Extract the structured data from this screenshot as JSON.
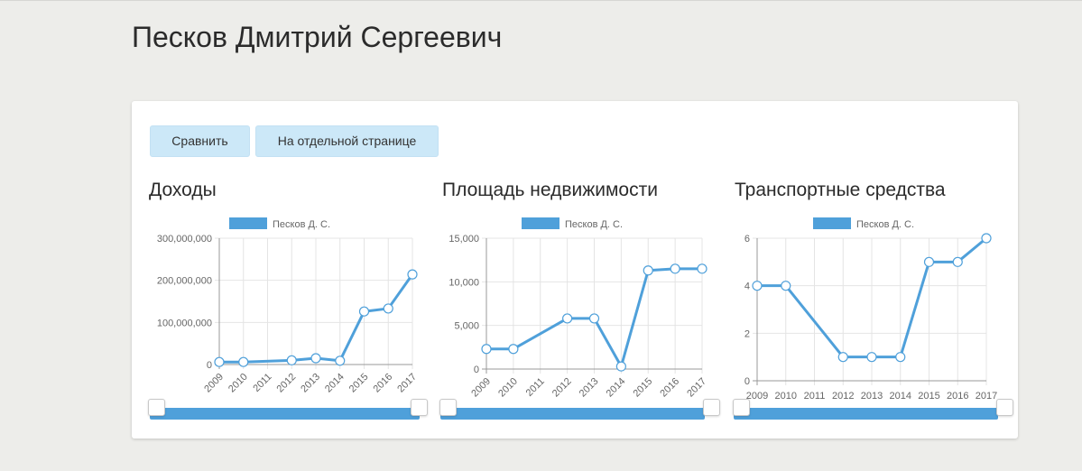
{
  "page": {
    "title": "Песков Дмитрий Сергеевич"
  },
  "toolbar": {
    "compare_label": "Сравнить",
    "separate_page_label": "На отдельной странице"
  },
  "colors": {
    "line": "#4fa0da",
    "grid": "#e4e4e4",
    "axis": "#999999"
  },
  "chart_data": [
    {
      "type": "line",
      "title": "Доходы",
      "categories": [
        "2009",
        "2010",
        "2011",
        "2012",
        "2013",
        "2014",
        "2015",
        "2016",
        "2017"
      ],
      "series": [
        {
          "name": "Песков Д. С.",
          "values": [
            6000000,
            6000000,
            null,
            10000000,
            15000000,
            9000000,
            126000000,
            133000000,
            214000000
          ]
        }
      ],
      "ylim": [
        0,
        300000000
      ],
      "yticks": [
        "0",
        "100,000,000",
        "200,000,000",
        "300,000,000"
      ],
      "ytick_values": [
        0,
        100000000,
        200000000,
        300000000
      ],
      "xlabel_rotated": true,
      "legend": "top-center",
      "grid": true
    },
    {
      "type": "line",
      "title": "Площадь недвижимости",
      "categories": [
        "2009",
        "2010",
        "2011",
        "2012",
        "2013",
        "2014",
        "2015",
        "2016",
        "2017"
      ],
      "series": [
        {
          "name": "Песков Д. С.",
          "values": [
            2300,
            2300,
            null,
            5800,
            5800,
            300,
            11300,
            11500,
            11500
          ]
        }
      ],
      "ylim": [
        0,
        15000
      ],
      "yticks": [
        "0",
        "5,000",
        "10,000",
        "15,000"
      ],
      "ytick_values": [
        0,
        5000,
        10000,
        15000
      ],
      "xlabel_rotated": true,
      "legend": "top-center",
      "grid": true
    },
    {
      "type": "line",
      "title": "Транспортные средства",
      "categories": [
        "2009",
        "2010",
        "2011",
        "2012",
        "2013",
        "2014",
        "2015",
        "2016",
        "2017"
      ],
      "series": [
        {
          "name": "Песков Д. С.",
          "values": [
            4,
            4,
            null,
            1,
            1,
            1,
            5,
            5,
            6
          ]
        }
      ],
      "ylim": [
        0,
        6
      ],
      "yticks": [
        "0",
        "2",
        "4",
        "6"
      ],
      "ytick_values": [
        0,
        2,
        4,
        6
      ],
      "xlabel_rotated": false,
      "legend": "top-center",
      "grid": true
    }
  ]
}
